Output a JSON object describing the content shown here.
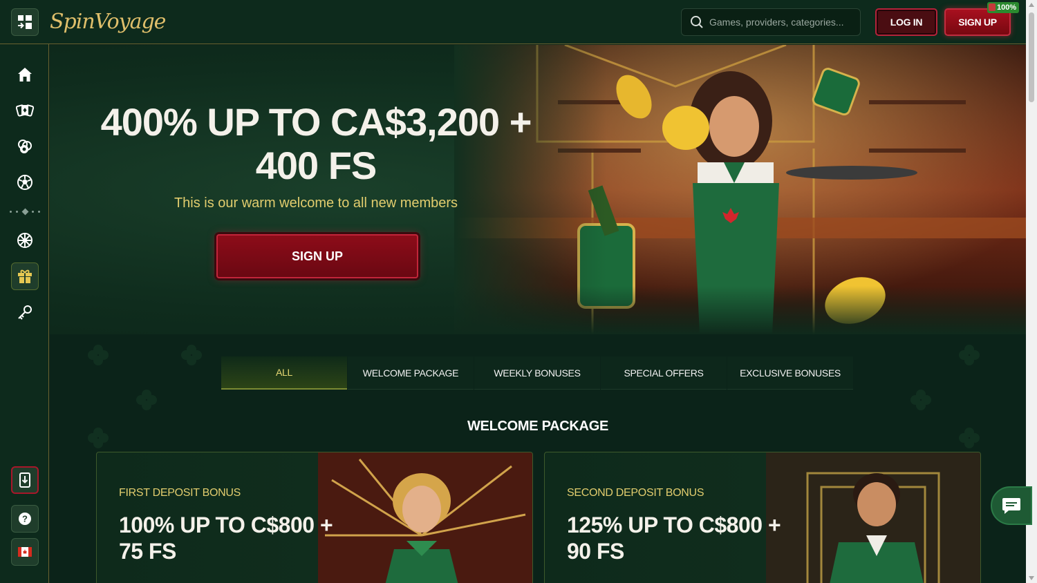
{
  "brand": {
    "logo_text": "SpinVoyage"
  },
  "header": {
    "search_placeholder": "Games, providers, categories...",
    "login_label": "LOG IN",
    "signup_label": "SIGN UP",
    "signup_badge": "100%"
  },
  "sidebar": {
    "items": [
      {
        "name": "home",
        "icon": "home-icon"
      },
      {
        "name": "casino",
        "icon": "cards-icon"
      },
      {
        "name": "live-casino",
        "icon": "chips-icon"
      },
      {
        "name": "sports",
        "icon": "soccer-ball-icon"
      },
      {
        "name": "wheel",
        "icon": "wheel-icon"
      },
      {
        "name": "promotions",
        "icon": "gift-icon",
        "active": true
      },
      {
        "name": "vip",
        "icon": "key-icon"
      }
    ],
    "bottom_items": [
      {
        "name": "install-app",
        "icon": "download-app-icon"
      },
      {
        "name": "help",
        "icon": "help-icon"
      },
      {
        "name": "language",
        "icon": "canada-flag-icon"
      }
    ]
  },
  "hero": {
    "title_line1": "400% UP TO CA$3,200 +",
    "title_line2": "400 FS",
    "subtitle": "This is our warm welcome to all new members",
    "cta_label": "SIGN UP"
  },
  "promo_tabs": [
    {
      "label": "ALL",
      "active": true
    },
    {
      "label": "WELCOME PACKAGE"
    },
    {
      "label": "WEEKLY BONUSES"
    },
    {
      "label": "SPECIAL OFFERS"
    },
    {
      "label": "EXCLUSIVE BONUSES"
    }
  ],
  "section": {
    "title": "WELCOME PACKAGE"
  },
  "cards": [
    {
      "label": "FIRST DEPOSIT BONUS",
      "title_line1": "100% UP TO C$800 +",
      "title_line2": "75 FS"
    },
    {
      "label": "SECOND DEPOSIT BONUS",
      "title_line1": "125% UP TO C$800 +",
      "title_line2": "90 FS"
    }
  ],
  "colors": {
    "background": "#0b2319",
    "accent_gold": "#e2cd6e",
    "button_red": "#8d0c19",
    "border_gold": "#6b6230"
  }
}
